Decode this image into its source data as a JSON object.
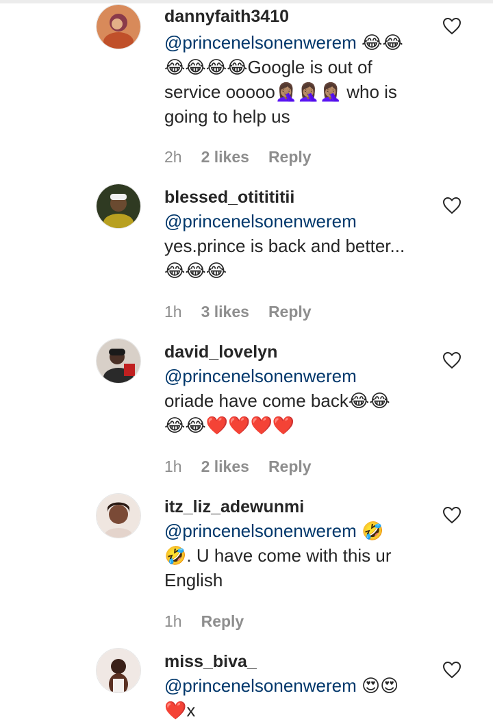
{
  "comments": [
    {
      "username": "dannyfaith3410",
      "mention": "@princenelsonenwerem",
      "text": " 😂😂\n😂😂😂😂Google is out of\nservice ooooo🤦🏽‍♀️🤦🏽‍♀️🤦🏽‍♀️ who is\ngoing to help us",
      "time": "2h",
      "likes": "2 likes",
      "reply": "Reply"
    },
    {
      "username": "blessed_otitititii",
      "mention": "@princenelsonenwerem",
      "text": "\nyes.prince is back and better...\n😂😂😂",
      "time": "1h",
      "likes": "3 likes",
      "reply": "Reply"
    },
    {
      "username": "david_lovelyn",
      "mention": "@princenelsonenwerem",
      "text": "\noriade have come back😂😂\n😂😂❤️❤️❤️❤️",
      "time": "1h",
      "likes": "2 likes",
      "reply": "Reply"
    },
    {
      "username": "itz_liz_adewunmi",
      "mention": "@princenelsonenwerem",
      "text": " 🤣\n🤣. U have come with this ur\nEnglish",
      "time": "1h",
      "likes": "",
      "reply": "Reply"
    },
    {
      "username": "miss_biva_",
      "mention": "@princenelsonenwerem",
      "text": " 😍😍\n❤️x",
      "time": "",
      "likes": "",
      "reply": ""
    }
  ],
  "icons": {
    "like": "heart-outline-icon"
  },
  "colors": {
    "mention": "#00376b",
    "meta": "#8e8e8e",
    "text": "#262626"
  }
}
